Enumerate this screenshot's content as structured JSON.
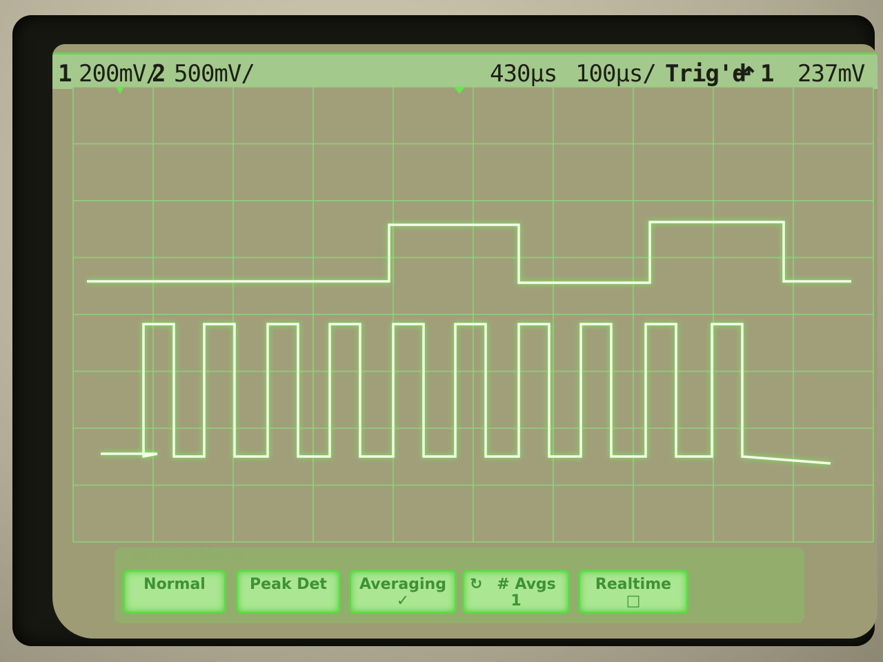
{
  "status": {
    "ch1_number": "1",
    "ch1_scale": "200mV/",
    "ch2_number": "2",
    "ch2_scale": "500mV/",
    "time_delay": "430µs",
    "time_base": "100µs/",
    "trigger_state": "Trig'd",
    "trigger_source": "1",
    "trigger_level": "237mV"
  },
  "menu": {
    "title": "Acquire Menu",
    "softkeys": [
      {
        "label": "Normal",
        "sub": ""
      },
      {
        "label": "Peak Det",
        "sub": ""
      },
      {
        "label": "Averaging",
        "sub": "✓"
      },
      {
        "label": "# Avgs",
        "sub": "1"
      },
      {
        "label": "Realtime",
        "sub": "□"
      }
    ]
  },
  "colors": {
    "trace": "#f4ffe8",
    "grid": "#8fd47a",
    "screen": "#a19f7a",
    "softkey": "#abe692"
  },
  "icons": [
    "trigger-marker-icon",
    "ch1-ground-marker-icon",
    "rising-edge-icon",
    "rotary-knob-icon"
  ]
}
